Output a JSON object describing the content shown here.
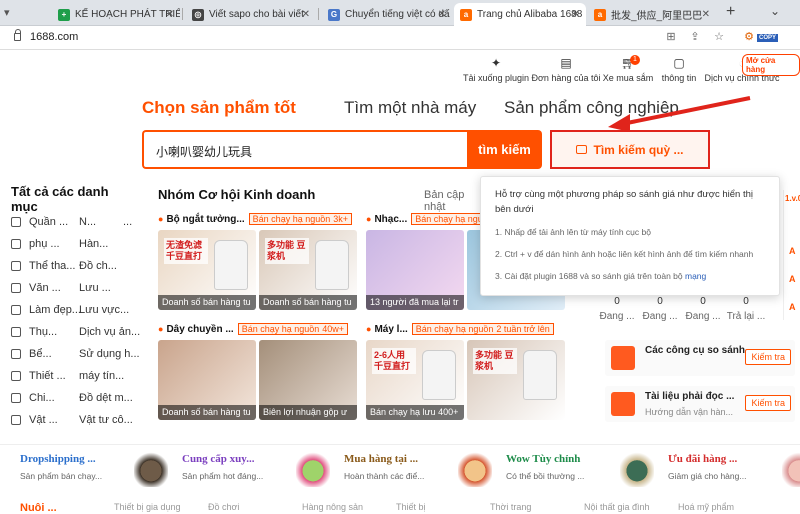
{
  "browser": {
    "tabs": [
      {
        "label": "KẾ HOẠCH PHÁT TRIỂN",
        "color": "#1e9e4a",
        "glyph": "+"
      },
      {
        "label": "Viết sapo cho bài viết",
        "color": "#444",
        "glyph": "◎"
      },
      {
        "label": "Chuyển tiếng việt có dấ",
        "color": "#4a78c9",
        "glyph": "G"
      },
      {
        "label": "Trang chủ Alibaba 1688",
        "color": "#ff6a00",
        "glyph": "a"
      },
      {
        "label": "批发_供应_阿里巴巴",
        "color": "#ff6a00",
        "glyph": "a"
      }
    ],
    "new_tab": "+",
    "url": "1688.com",
    "copy_badge": "COPY"
  },
  "top_links": [
    {
      "label": "Tải xuống plugin",
      "icon": "plugin-icon"
    },
    {
      "label": "Đơn hàng của tôi",
      "icon": "orders-icon"
    },
    {
      "label": "Xe mua sắm",
      "icon": "cart-icon",
      "badge": "1"
    },
    {
      "label": "thông tin",
      "icon": "message-icon"
    },
    {
      "label": "Dịch vụ chính thức",
      "icon": "service-icon"
    }
  ],
  "open_shop_label": "Mở cửa hàng",
  "nav": {
    "items": [
      "Chọn sản phẩm tốt",
      "Tìm một nhà máy",
      "Sản phẩm công nghiệp"
    ]
  },
  "search": {
    "value": "小喇叭婴幼儿玩具",
    "button": "tìm kiếm",
    "image_search": "Tìm kiếm quỳ ..."
  },
  "categories": {
    "title": "Tất cả các danh mục",
    "rows": [
      [
        "Quần ...",
        "N...",
        "..."
      ],
      [
        "phụ ...",
        "Hàn..."
      ],
      [
        "Thể tha...",
        "Đồ ch..."
      ],
      [
        "Văn ...",
        "Lưu ..."
      ],
      [
        "Làm đẹp...",
        "Lưu vực..."
      ],
      [
        "Thụ...",
        "Dịch vụ ản..."
      ],
      [
        "Bể...",
        "Sử dụng h..."
      ],
      [
        "Thiết ...",
        "máy tín..."
      ],
      [
        "Chi...",
        "Đồ dệt m..."
      ],
      [
        "Vật ...",
        "Vật tư cô..."
      ]
    ]
  },
  "opportunities": {
    "title": "Nhóm Cơ hội Kinh doanh",
    "update": "Bản cập nhật",
    "groups": [
      {
        "title": "Bộ ngắt tưởng...",
        "hot": "Bán chạy hạ nguồn",
        "count": "3k+",
        "images": [
          {
            "caption": "Doanh số bán hàng tu",
            "c1": "#e9d6c2",
            "c2": "#fff",
            "label": "无渣免滤 千豆直打"
          },
          {
            "caption": "Doanh số bán hàng tu",
            "c1": "#d9c8b8",
            "c2": "#fff",
            "label": "多功能 豆浆机"
          }
        ]
      },
      {
        "title": "Nhạc...",
        "hot": "Bán chạy hạ nguồn",
        "count": "",
        "images": [
          {
            "caption": "13 người đã mua lại tr",
            "c1": "#c9b6e4",
            "c2": "#f4d9f0",
            "label": ""
          },
          {
            "caption": "",
            "c1": "#9cc6de",
            "c2": "#e0edf7",
            "label": ""
          }
        ]
      },
      {
        "title": "Dây chuyền ...",
        "hot": "Bán chạy hạ nguồn",
        "count": "40w+",
        "images": [
          {
            "caption": "Doanh số bán hàng tu",
            "c1": "#c9a48c",
            "c2": "#f3e6dc",
            "label": ""
          },
          {
            "caption": "Biên lợi nhuận gộp ư",
            "c1": "#a48f7a",
            "c2": "#e8ddd4",
            "label": ""
          }
        ]
      },
      {
        "title": "Máy l...",
        "hot": "Bán chạy hạ nguồn",
        "count": "2 tuần trở lên",
        "images": [
          {
            "caption": "Bán chạy hạ lưu 400+",
            "c1": "#e8d7c8",
            "c2": "#fff",
            "label": "2-6人用 千豆直打"
          },
          {
            "caption": "",
            "c1": "#d7c6b8",
            "c2": "#fff",
            "label": "多功能 豆浆机"
          }
        ]
      }
    ]
  },
  "popup": {
    "title": "Hỗ trợ cùng một phương pháp so sánh giá như được hiển thị bên dưới",
    "steps": [
      "1. Nhấp để tải ảnh lên từ máy tính cục bộ",
      "2. Ctrl + v để dán hình ảnh hoặc liên kết hình ảnh để tìm kiếm nhanh",
      "3. Cài đặt plugin 1688 và so sánh giá trên toàn bộ"
    ],
    "step3_link": "mạng"
  },
  "status_counts": [
    "0",
    "0",
    "0",
    "0"
  ],
  "status_labels": [
    "Đang ...",
    "Đang ...",
    "Đang ...",
    "Trả lại ..."
  ],
  "tools": [
    {
      "title": "Các công cụ so sánh ...",
      "subtitle": "",
      "button": "Kiếm tra"
    },
    {
      "title": "Tài liệu phải đọc ...",
      "subtitle": "Hướng dẫn vận hàn...",
      "button": "Kiếm tra"
    }
  ],
  "right_edge": {
    "top": "1.v.0",
    "items": [
      "A",
      "A",
      "A"
    ]
  },
  "promos": [
    {
      "title": "Dropshipping ...",
      "subtitle": "Sản phẩm bán chạy...",
      "color": "#2b6fcc",
      "c1": "#6e5b48",
      "c2": "#3a2f24"
    },
    {
      "title": "Cung cấp xuy...",
      "subtitle": "Sản phẩm hot đáng...",
      "color": "#7b3fbf",
      "c1": "#9fd36a",
      "c2": "#e04f7f"
    },
    {
      "title": "Mua hàng tại ...",
      "subtitle": "Hoàn thành các điể...",
      "color": "#8a5a1a",
      "c1": "#f2c489",
      "c2": "#d5552e"
    },
    {
      "title": "Wow Tùy chỉnh",
      "subtitle": "Có thể bồi thường ...",
      "color": "#1e8c4a",
      "c1": "#3c6d55",
      "c2": "#c7b58a"
    },
    {
      "title": "Ưu đãi hàng ...",
      "subtitle": "Giảm giá cho hàng...",
      "color": "#d42e2e",
      "c1": "#f2c2b8",
      "c2": "#d98c8c"
    }
  ],
  "bottom_links": [
    "Nuôi ...",
    "Thiết bị gia dụng",
    "Đồ chơi",
    "Hàng nông sản",
    "Thiết bị",
    "Thời trang",
    "Nội thất gia đình",
    "Hoá mỹ phẩm"
  ]
}
